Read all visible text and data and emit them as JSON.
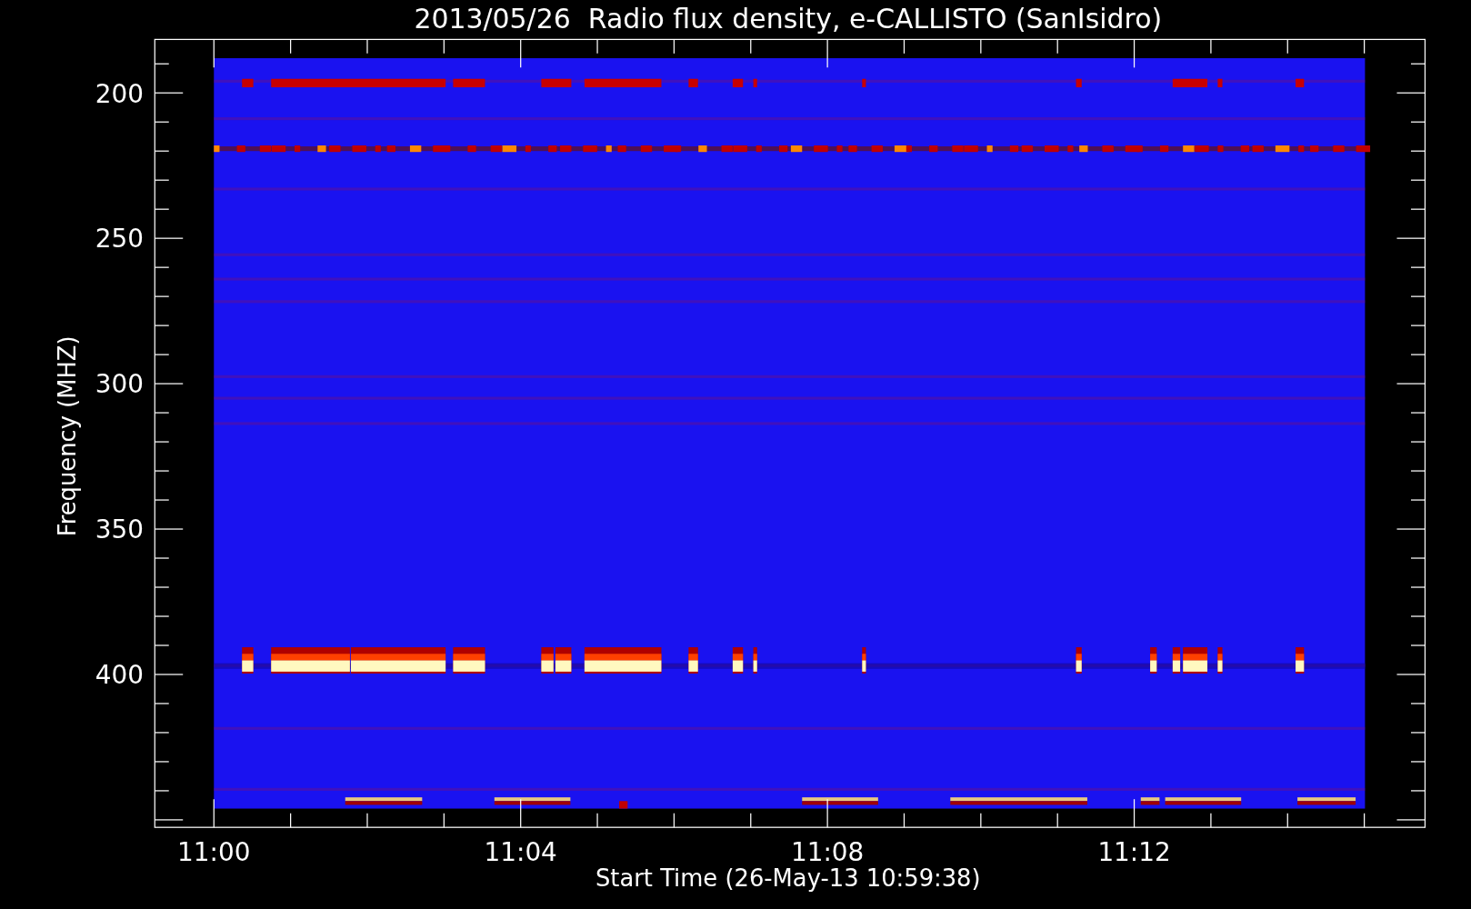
{
  "title": "2013/05/26  Radio flux density, e-CALLISTO (SanIsidro)",
  "plot": {
    "ylabel": "Frequency (MHZ)",
    "xlabel": "Start Time (26-May-13 10:59:38)",
    "yticks": [
      "200",
      "250",
      "300",
      "350",
      "400"
    ],
    "xticks": [
      "11:00",
      "11:04",
      "11:08",
      "11:12"
    ]
  }
}
